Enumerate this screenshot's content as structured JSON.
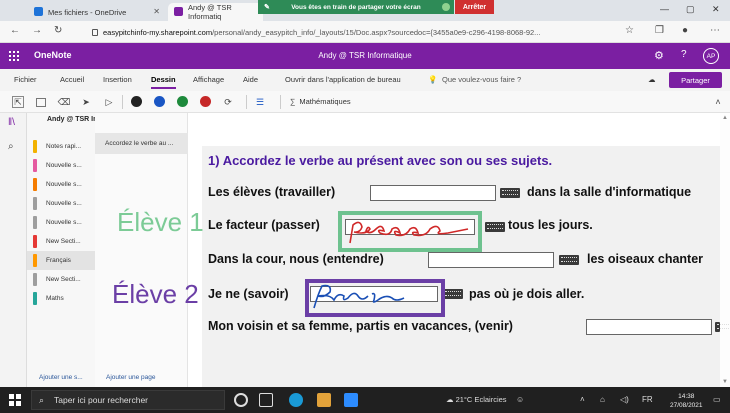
{
  "browser": {
    "tabs": [
      {
        "label": "Mes fichiers - OneDrive",
        "active": false
      },
      {
        "label": "Andy @ TSR Informatiq",
        "active": true
      }
    ],
    "share_banner": "Vous êtes en train de partager votre écran",
    "stop_label": "Arrêter",
    "url_host": "easypitchinfo-my.sharepoint.com",
    "url_rest": "/personal/andy_easypitch_info/_layouts/15/Doc.aspx?sourcedoc={3455a0e9-c296-4198-8068-92..."
  },
  "onenote": {
    "app_name": "OneNote",
    "doc_title": "Andy @ TSR Informatique",
    "avatar": "AP",
    "ribbon_tabs": [
      "Fichier",
      "Accueil",
      "Insertion",
      "Dessin",
      "Affichage",
      "Aide"
    ],
    "active_tab": "Dessin",
    "open_desktop": "Ouvrir dans l'application de bureau",
    "tell_me": "Que voulez-vous faire ?",
    "share_label": "Partager",
    "math_label": "Mathématiques",
    "pen_colors": [
      "#222222",
      "#1a56c4",
      "#1e8a3c",
      "#c62828"
    ]
  },
  "navigation": {
    "notebook": "Andy @ TSR Informatique",
    "sections": [
      {
        "label": "Notes rapi...",
        "color": "#f2b200"
      },
      {
        "label": "Nouvelle s...",
        "color": "#e55aa0"
      },
      {
        "label": "Nouvelle s...",
        "color": "#f57c00"
      },
      {
        "label": "Nouvelle s...",
        "color": "#9e9e9e"
      },
      {
        "label": "Nouvelle s...",
        "color": "#9e9e9e"
      },
      {
        "label": "New Secti...",
        "color": "#e53935"
      },
      {
        "label": "Français",
        "color": "#ff9800",
        "selected": true
      },
      {
        "label": "New Secti...",
        "color": "#9e9e9e"
      },
      {
        "label": "Maths",
        "color": "#26a69a"
      }
    ],
    "page": "Accordez le verbe au ...",
    "add_section": "Ajouter une s...",
    "add_page": "Ajouter une page"
  },
  "exercise": {
    "title": "1) Accordez le verbe au présent avec son ou ses sujets.",
    "lines": [
      {
        "before": "Les élèves (travailler)",
        "after": "dans la salle d'informatique"
      },
      {
        "before": "Le facteur (passer)",
        "after": "tous les jours.",
        "handwriting": "passe"
      },
      {
        "before": "Dans la cour, nous (entendre)",
        "after": "les oiseaux chanter"
      },
      {
        "before": "Je ne (savoir)",
        "after": "pas où je dois aller.",
        "handwriting": "sais"
      },
      {
        "before": "Mon voisin et sa femme, partis en vacances, (venir)",
        "after": ""
      }
    ],
    "eleve1": "Élève 1",
    "eleve2": "Élève 2",
    "eleve1_color": "#7ccb96",
    "eleve2_color": "#6b3fa6"
  },
  "taskbar": {
    "search_placeholder": "Taper ici pour rechercher",
    "weather": "21°C  Eclaircies",
    "time": "14:38",
    "date": "27/08/2021"
  }
}
